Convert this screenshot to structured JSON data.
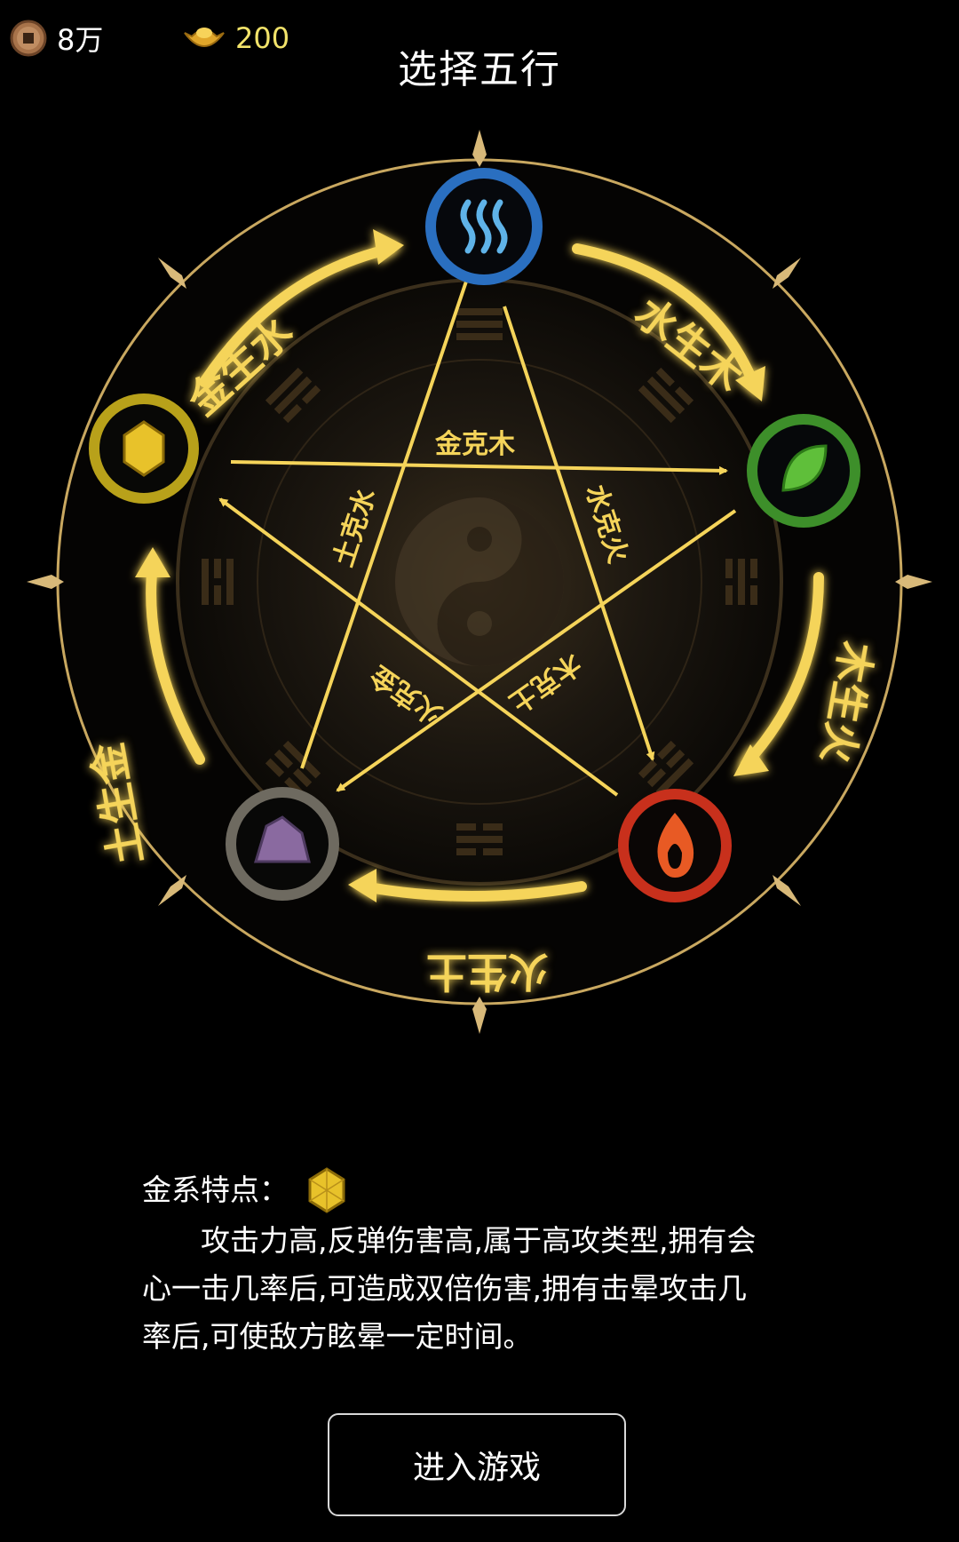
{
  "resources": {
    "coins": "8万",
    "ingots": "200"
  },
  "title": "选择五行",
  "wheel": {
    "elements": [
      {
        "key": "water",
        "color": "#2a6fc0",
        "icon": "water-wave-icon"
      },
      {
        "key": "wood",
        "color": "#3d8f2a",
        "icon": "leaf-icon"
      },
      {
        "key": "fire",
        "color": "#c8301c",
        "icon": "flame-icon"
      },
      {
        "key": "earth",
        "color": "#6e6a60",
        "icon": "purple-rock-icon"
      },
      {
        "key": "metal",
        "color": "#b8a11a",
        "icon": "gold-gem-icon"
      }
    ],
    "generating": {
      "metal_water": "金生水",
      "water_wood": "水生木",
      "wood_fire": "木生火",
      "fire_earth": "火生土",
      "earth_metal": "土生金"
    },
    "overcoming": {
      "metal_wood": "金克木",
      "water_fire": "水克火",
      "wood_earth": "木克土",
      "fire_metal": "火克金",
      "earth_water": "土克水"
    },
    "colors": {
      "gold": "#f5d45a",
      "ring": "#c9a860",
      "disc": "#120f0a"
    }
  },
  "description": {
    "heading": "金系特点：",
    "icon": "gold-gem-icon",
    "body": "攻击力高,反弹伤害高,属于高攻类型,拥有会心一击几率后,可造成双倍伤害,拥有击晕攻击几率后,可使敌方眩晕一定时间。"
  },
  "enter_button": "进入游戏"
}
